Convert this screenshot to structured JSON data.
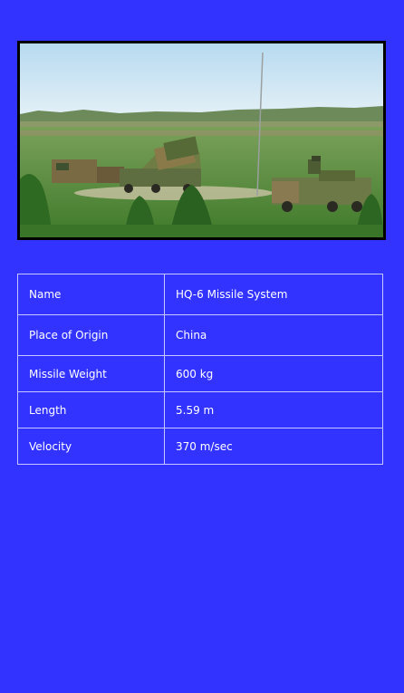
{
  "image": {
    "icon": "missile-system-photo",
    "colors": {
      "sky": "#cfe6f4",
      "grass": "#5d8f3c",
      "background": "#3333ff"
    }
  },
  "specs": {
    "rows": [
      {
        "label": "Name",
        "value": "HQ-6 Missile System"
      },
      {
        "label": "Place of Origin",
        "value": "China"
      },
      {
        "label": "Missile Weight",
        "value": "600 kg"
      },
      {
        "label": "Length",
        "value": "5.59 m"
      },
      {
        "label": "Velocity",
        "value": "370 m/sec"
      }
    ]
  }
}
